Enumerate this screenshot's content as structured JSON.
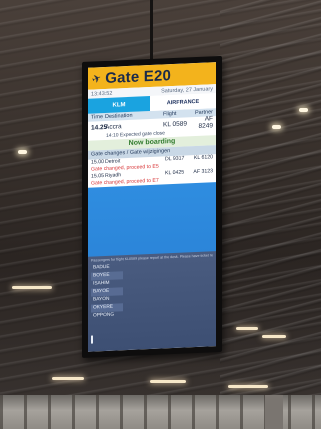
{
  "board": {
    "gate_title": "Gate E20",
    "time": "13:43:52",
    "date": "Saturday, 27 January",
    "airline_left": "KLM",
    "airline_right": "AIRFRANCE",
    "columns": {
      "time": "Time",
      "destination": "Destination",
      "flight": "Flight",
      "partner": "Partner"
    },
    "flight": {
      "time": "14.25",
      "destination": "Accra",
      "flight": "KL 0589",
      "partner": "AF 8249"
    },
    "expected": "14:10 Expected gate close",
    "status": "Now boarding",
    "changes_header": "Gate changes / Gate wijzigingen",
    "changes": [
      {
        "time": "15.00",
        "destination": "Detroit",
        "flight": "DL 9317",
        "partner": "KL 6120",
        "note": "Gate changed, proceed to E5"
      },
      {
        "time": "15.05",
        "destination": "Riyadh",
        "flight": "KL 0425",
        "partner": "AF 3123",
        "note": "Gate changed, proceed to E7"
      }
    ],
    "passenger_note": "Passengers for flight KL0589 please report at the desk. Please have ticket ready",
    "names": [
      "BADUE",
      "BOYEE",
      "ISAHIM",
      "BAYOE",
      "BAYON",
      "OKYERE",
      "OPPONG"
    ]
  },
  "colors": {
    "header": "#f3b31c",
    "klm_blue": "#1aa3e0",
    "boarding_green": "#2f7a2c",
    "alert_red": "#d8383a",
    "screen_blue": "#2f8de0"
  }
}
